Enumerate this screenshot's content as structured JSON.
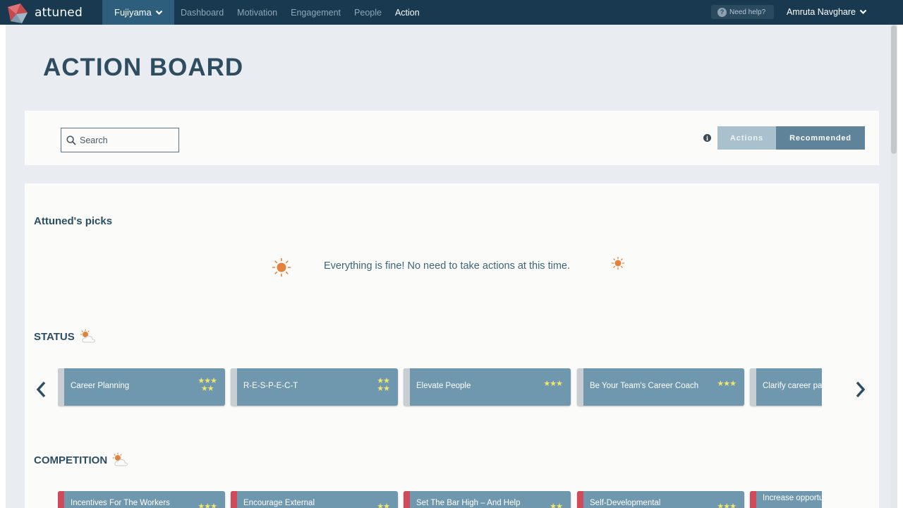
{
  "app": {
    "brand": "attuned"
  },
  "header": {
    "org": "Fujiyama",
    "nav": [
      "Dashboard",
      "Motivation",
      "Engagement",
      "People",
      "Action"
    ],
    "active_nav": "Action",
    "help": "Need help?",
    "user": "Amruta Navghare"
  },
  "page": {
    "title": "ACTION BOARD"
  },
  "filters": {
    "search_placeholder": "Search",
    "toggle": {
      "actions": "Actions",
      "recommended": "Recommended",
      "selected": "Recommended"
    }
  },
  "picks": {
    "heading": "Attuned's picks",
    "message": "Everything is fine! No need to take actions at this time."
  },
  "status": {
    "heading": "STATUS",
    "cards": [
      {
        "label": "Career Planning",
        "stars": 5,
        "edge": "grey"
      },
      {
        "label": "R-E-S-P-E-C-T",
        "stars": 4,
        "edge": "grey"
      },
      {
        "label": "Elevate People",
        "stars": 3,
        "edge": "grey"
      },
      {
        "label": "Be Your Team's Career Coach",
        "stars": 3,
        "edge": "grey"
      },
      {
        "label": "Clarify career pa",
        "stars": 0,
        "edge": "grey"
      }
    ]
  },
  "competition": {
    "heading": "COMPETITION",
    "cards": [
      {
        "label": "Incentives For The Workers",
        "stars": 3,
        "edge": "red"
      },
      {
        "label": "Encourage External",
        "stars": 2,
        "edge": "red"
      },
      {
        "label": "Set The Bar High – And Help",
        "stars": 2,
        "edge": "red"
      },
      {
        "label": "Self-Developmental",
        "stars": 3,
        "edge": "red"
      },
      {
        "label": "Increase opportu",
        "stars": 0,
        "edge": "red"
      }
    ]
  },
  "colors": {
    "topbar": "#18394f",
    "org_tab": "#2d5f7c",
    "card": "#6f97ad",
    "star": "#f3e46e",
    "accent_red": "#cf4b5b",
    "sun": "#e2823c"
  }
}
